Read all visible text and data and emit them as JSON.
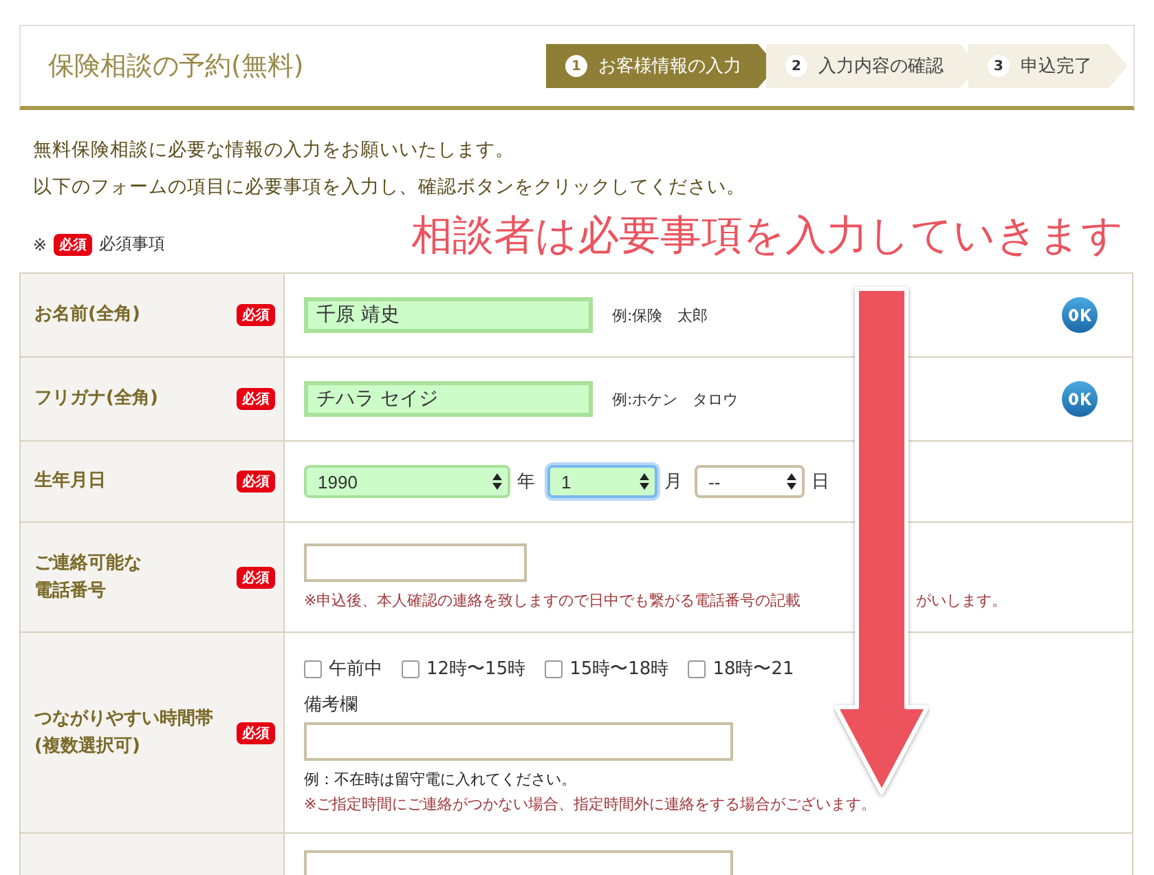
{
  "header": {
    "title": "保険相談の予約(無料)",
    "steps": [
      {
        "number": "1",
        "label": "お客様情報の入力",
        "selected": true
      },
      {
        "number": "2",
        "label": "入力内容の確認",
        "selected": false
      },
      {
        "number": "3",
        "label": "申込完了",
        "selected": false
      }
    ]
  },
  "intro": [
    "無料保険相談に必要な情報の入力をお願いいたします。",
    "以下のフォームの項目に必要事項を入力し、確認ボタンをクリックしてください。"
  ],
  "legend": {
    "mark": "※",
    "badge": "必須",
    "text": "必須事項"
  },
  "annotation": {
    "text": "相談者は必要事項を入力していきます"
  },
  "rows": [
    {
      "kind": "text",
      "label": "お名前(全角)",
      "badge": "必須",
      "value": "千原 靖史",
      "hint": "例:保険　太郎",
      "ok": true
    },
    {
      "kind": "text",
      "label": "フリガナ(全角)",
      "badge": "必須",
      "value": "チハラ セイジ",
      "hint": "例:ホケン　タロウ",
      "ok": true
    },
    {
      "kind": "date",
      "label": "生年月日",
      "badge": "必須",
      "selects": [
        {
          "value": "1990",
          "unit": "年",
          "filled": true,
          "focused": false
        },
        {
          "value": "1",
          "unit": "月",
          "filled": true,
          "focused": true
        },
        {
          "value": "--",
          "unit": "日",
          "filled": false,
          "focused": false
        }
      ]
    },
    {
      "kind": "phone",
      "label": "ご連絡可能な",
      "label_2": "電話番号",
      "badge": "必須",
      "notes": [
        "※申込後、本人確認の連絡を致しますので日中でも繋がる電話番号の記載",
        "がいします。"
      ]
    },
    {
      "kind": "times",
      "label": "つながりやすい時間帯",
      "label_2": "(複数選択可)",
      "badge": "必須",
      "options": [
        {
          "label": "午前中",
          "checked": false
        },
        {
          "label": "12時〜15時",
          "checked": false
        },
        {
          "label": "15時〜18時",
          "checked": false
        },
        {
          "label": "18時〜21",
          "checked": false
        }
      ],
      "memo_label": "備考欄",
      "example": "例：不在時は留守電に入れてください。",
      "note": "※ご指定時間にご連絡がつかない場合、指定時間外に連絡をする場合がございます。"
    },
    {
      "kind": "partial"
    }
  ]
}
